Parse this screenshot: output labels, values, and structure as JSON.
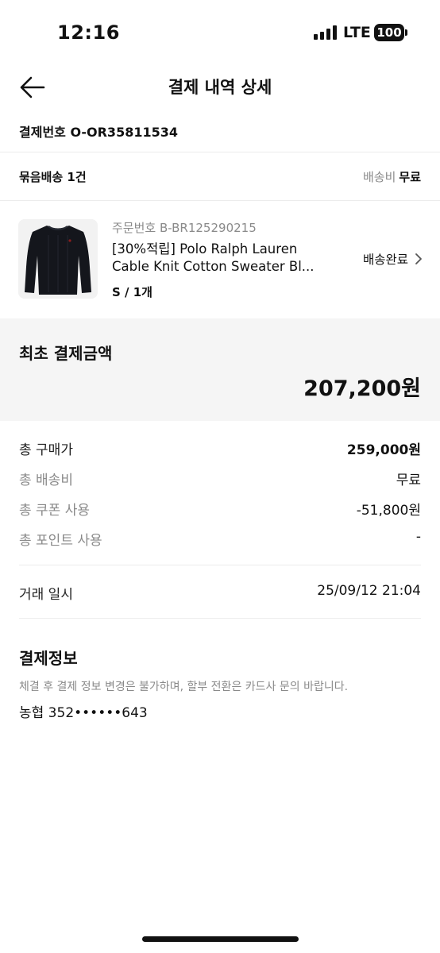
{
  "status_bar": {
    "time": "12:16",
    "network": "LTE",
    "battery": "100"
  },
  "header": {
    "title": "결제 내역 상세"
  },
  "order": {
    "label": "결제번호",
    "number": "O-OR35811534"
  },
  "bundle": {
    "label": "묶음배송 1건",
    "shipping_label": "배송비",
    "shipping_value": "무료"
  },
  "product": {
    "order_no": "주문번호 B-BR125290215",
    "name_line1": "[30%적립] Polo Ralph Lauren",
    "name_line2": "Cable Knit Cotton Sweater Bl...",
    "option": "S / 1개",
    "status": "배송완료",
    "icon": "chevron-right-icon"
  },
  "initial_total": {
    "label": "최초 결제금액",
    "value": "207,200원"
  },
  "summary": [
    {
      "label": "총 구매가",
      "value": "259,000원"
    },
    {
      "label": "총 배송비",
      "value": "무료"
    },
    {
      "label": "총 쿠폰 사용",
      "value": "-51,800원"
    },
    {
      "label": "총 포인트 사용",
      "value": "-"
    }
  ],
  "transaction": {
    "label": "거래 일시",
    "value": "25/09/12 21:04"
  },
  "payment_info": {
    "title": "결제정보",
    "notice": "체결 후 결제 정보 변경은 불가하며, 할부 전환은 카드사 문의 바랍니다.",
    "card": "농협 352••••••643"
  }
}
